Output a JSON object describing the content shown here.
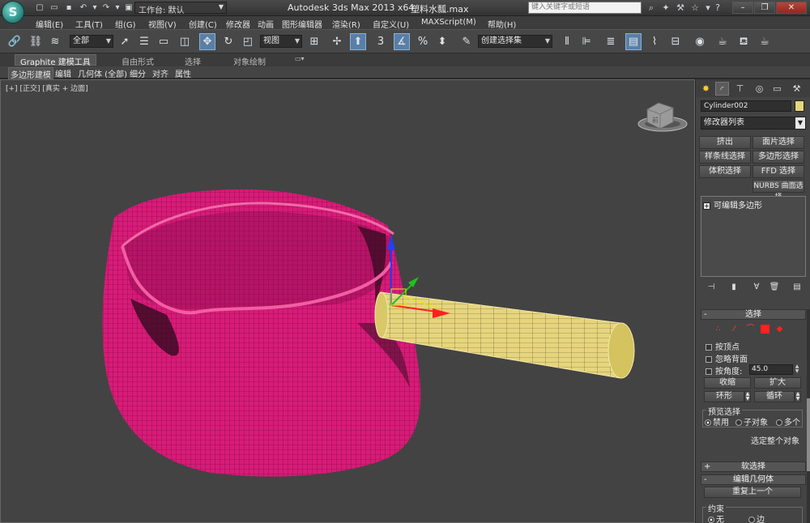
{
  "title_bar": {
    "app_logo": "S",
    "workspace_label": "工作台: 默认",
    "app_title": "Autodesk 3ds Max  2013 x64",
    "file_name": "塑料水瓢.max",
    "search_placeholder": "键入关键字或短语",
    "help_label": "?"
  },
  "menu": [
    "编辑(E)",
    "工具(T)",
    "组(G)",
    "视图(V)",
    "创建(C)",
    "修改器",
    "动画",
    "图形编辑器",
    "渲染(R)",
    "自定义(U)",
    "MAXScript(M)",
    "帮助(H)"
  ],
  "toolbar": {
    "selection_filter": "全部",
    "ref_coord": "视图",
    "angle_snap": "3",
    "named_selection": "创建选择集"
  },
  "ribbon": {
    "tabs": [
      "Graphite 建模工具",
      "自由形式",
      "选择",
      "对象绘制"
    ],
    "sub_items": [
      "多边形建模",
      "编辑",
      "几何体 (全部)",
      "细分",
      "对齐",
      "属性"
    ]
  },
  "viewport": {
    "label_plus": "[+]",
    "label_view": "[正交]",
    "label_shading": "[真实 + 边面]",
    "viewcube_text": "前"
  },
  "command_panel": {
    "object_name": "Cylinder002",
    "object_color": "#e6d57d",
    "modifier_list": "修改器列表",
    "mod_buttons": [
      "挤出",
      "面片选择",
      "样条线选择",
      "多边形选择",
      "体积选择",
      "FFD 选择",
      "NURBS 曲面选择"
    ],
    "stack_item": "可编辑多边形",
    "selection_rollout": {
      "title": "选择",
      "by_vertex": "按顶点",
      "ignore_backfacing": "忽略背面",
      "by_angle": "按角度:",
      "angle_value": "45.0",
      "shrink": "收缩",
      "grow": "扩大",
      "ring": "环形",
      "loop": "循环",
      "preview_group": "预览选择",
      "preview_off": "禁用",
      "preview_subobj": "子对象",
      "preview_multi": "多个",
      "select_whole": "选定整个对象"
    },
    "soft_selection": "软选择",
    "edit_geometry": "编辑几何体",
    "repeat_last": "重复上一个",
    "constraints_group": "约束",
    "constraint_none": "无",
    "constraint_edge": "边"
  },
  "colors": {
    "pot_magenta": "#d81b78",
    "handle_yellow": "#e6d57d",
    "viewport_bg": "#434343"
  }
}
